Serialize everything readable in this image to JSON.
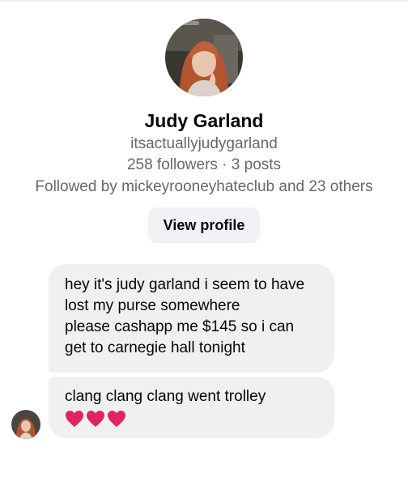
{
  "profile": {
    "name": "Judy Garland",
    "username": "itsactuallyjudygarland",
    "stats": "258 followers · 3 posts",
    "followed_by": "Followed by mickeyrooneyhateclub and 23 others",
    "view_profile_label": "View profile"
  },
  "messages": [
    {
      "lines": [
        "hey it's judy garland i seem to have",
        "lost my purse somewhere",
        "please cashapp me $145 so i can",
        "get to carnegie hall tonight"
      ]
    },
    {
      "lines": [
        "clang clang clang went trolley"
      ],
      "emoji": [
        "red-heart",
        "red-heart",
        "red-heart"
      ]
    }
  ],
  "colors": {
    "bubble": "#f0f0f0",
    "button": "#f0f2f5",
    "secondary_text": "#65676b",
    "heart": "#e0245e"
  }
}
